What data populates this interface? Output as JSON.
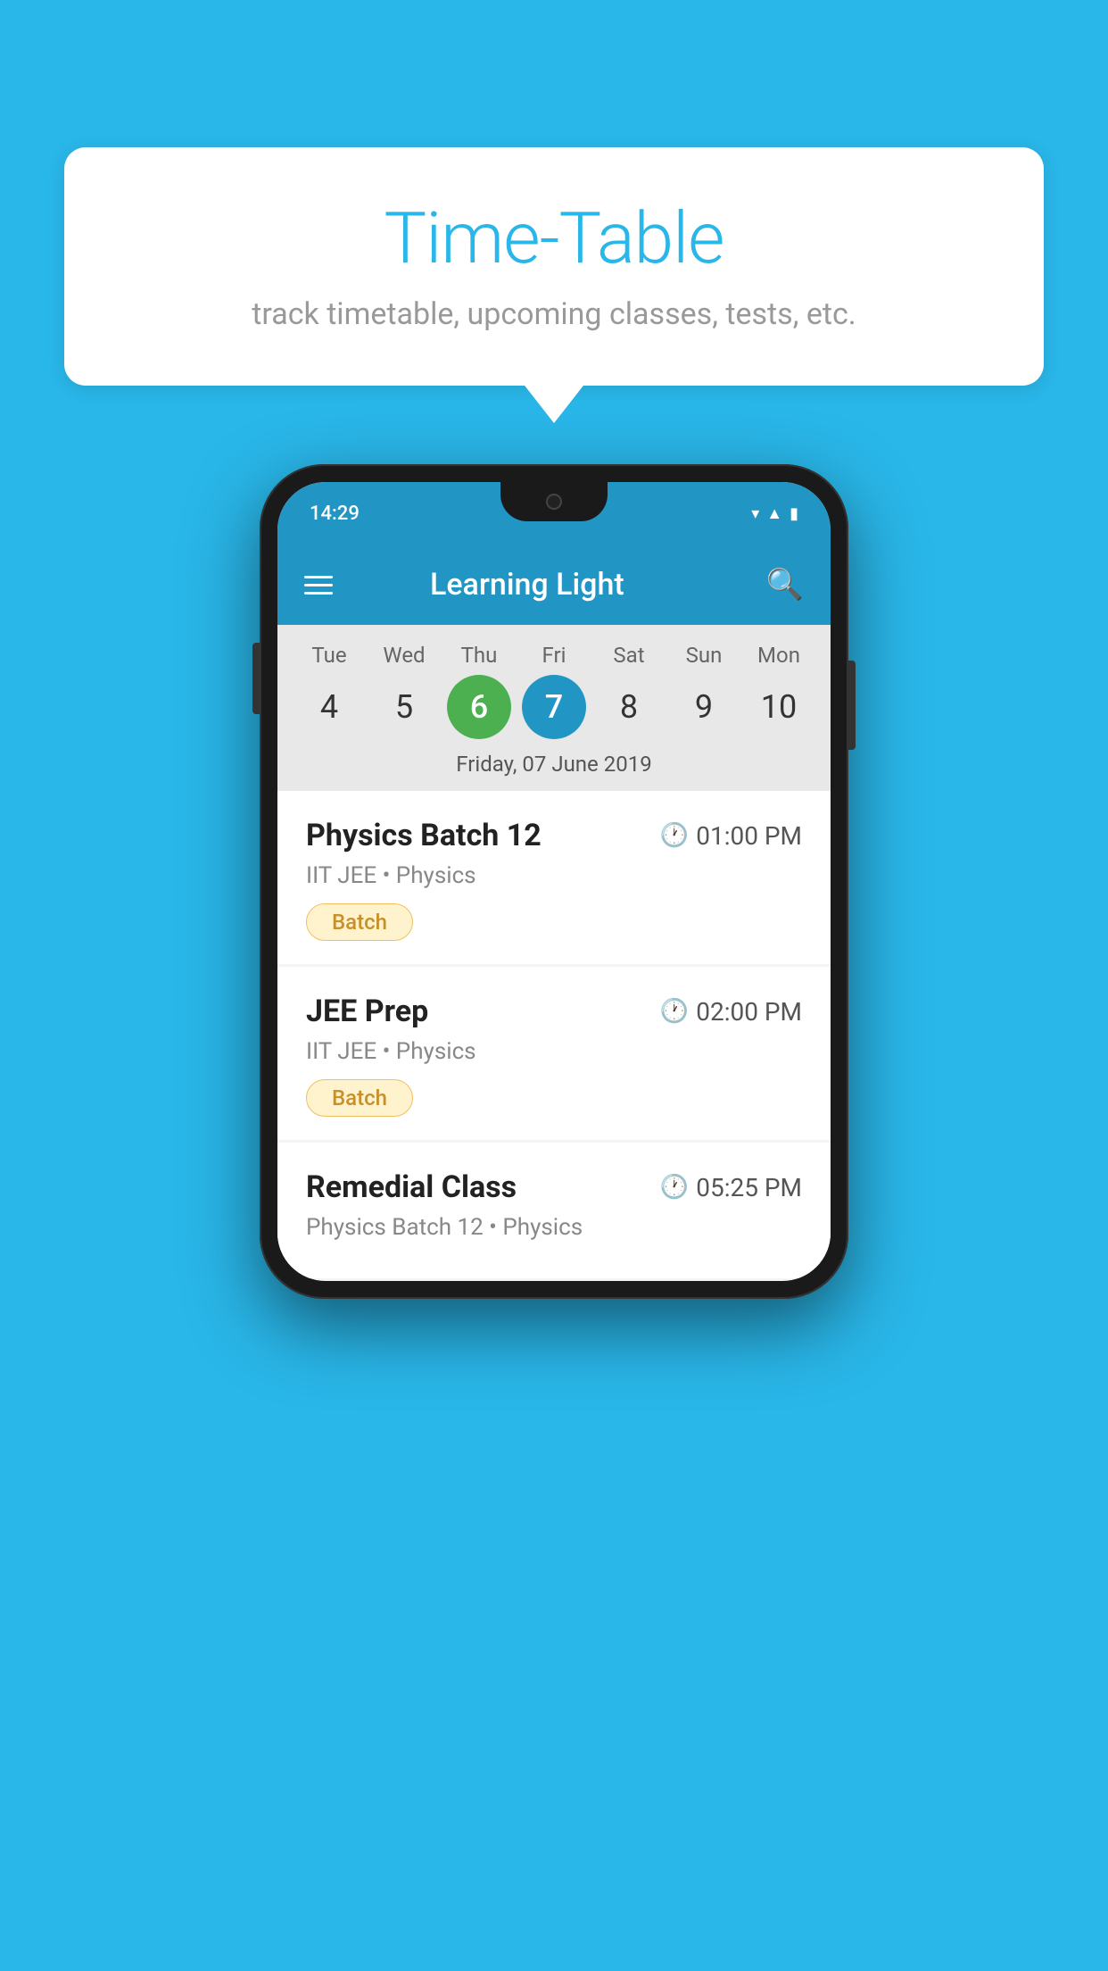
{
  "background": {
    "color": "#29b6e8"
  },
  "speech_bubble": {
    "title": "Time-Table",
    "subtitle": "track timetable, upcoming classes, tests, etc."
  },
  "phone": {
    "status_bar": {
      "time": "14:29"
    },
    "app_bar": {
      "title": "Learning Light"
    },
    "calendar": {
      "days": [
        {
          "name": "Tue",
          "number": "4",
          "state": "normal"
        },
        {
          "name": "Wed",
          "number": "5",
          "state": "normal"
        },
        {
          "name": "Thu",
          "number": "6",
          "state": "today"
        },
        {
          "name": "Fri",
          "number": "7",
          "state": "selected"
        },
        {
          "name": "Sat",
          "number": "8",
          "state": "normal"
        },
        {
          "name": "Sun",
          "number": "9",
          "state": "normal"
        },
        {
          "name": "Mon",
          "number": "10",
          "state": "normal"
        }
      ],
      "selected_date_label": "Friday, 07 June 2019"
    },
    "schedule": [
      {
        "title": "Physics Batch 12",
        "time": "01:00 PM",
        "subtitle": "IIT JEE • Physics",
        "badge": "Batch"
      },
      {
        "title": "JEE Prep",
        "time": "02:00 PM",
        "subtitle": "IIT JEE • Physics",
        "badge": "Batch"
      },
      {
        "title": "Remedial Class",
        "time": "05:25 PM",
        "subtitle": "Physics Batch 12 • Physics",
        "badge": null
      }
    ]
  }
}
